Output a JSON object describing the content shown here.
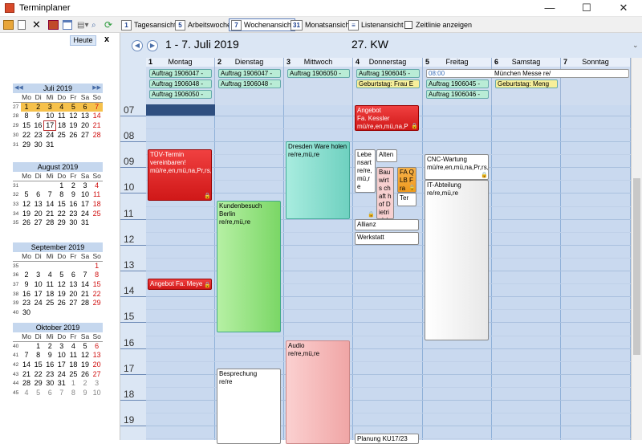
{
  "window": {
    "title": "Terminplaner",
    "minimize": "—",
    "maximize": "☐",
    "close": "✕"
  },
  "toolbar": {
    "views": [
      "Tagesansicht",
      "Arbeitswoche",
      "Wochenansicht",
      "Monatsansicht",
      "Listenansicht"
    ],
    "view_icons": [
      "1",
      "5",
      "7",
      "31",
      "≡"
    ],
    "timeline": "Zeitlinie anzeigen"
  },
  "sidebar": {
    "today_button": "Heute",
    "close": "x",
    "months": [
      {
        "title": "Juli 2019",
        "weekdays": [
          "Mo",
          "Di",
          "Mi",
          "Do",
          "Fr",
          "Sa",
          "So"
        ],
        "rows": [
          {
            "wk": "27",
            "days": [
              "1",
              "2",
              "3",
              "4",
              "5",
              "6",
              "7"
            ]
          },
          {
            "wk": "28",
            "days": [
              "8",
              "9",
              "10",
              "11",
              "12",
              "13",
              "14"
            ]
          },
          {
            "wk": "29",
            "days": [
              "15",
              "16",
              "17",
              "18",
              "19",
              "20",
              "21"
            ]
          },
          {
            "wk": "30",
            "days": [
              "22",
              "23",
              "24",
              "25",
              "26",
              "27",
              "28"
            ]
          },
          {
            "wk": "31",
            "days": [
              "29",
              "30",
              "31",
              "",
              "",
              "",
              ""
            ]
          }
        ]
      },
      {
        "title": "August 2019",
        "weekdays": [
          "Mo",
          "Di",
          "Mi",
          "Do",
          "Fr",
          "Sa",
          "So"
        ],
        "rows": [
          {
            "wk": "31",
            "days": [
              "",
              "",
              "",
              "1",
              "2",
              "3",
              "4"
            ]
          },
          {
            "wk": "32",
            "days": [
              "5",
              "6",
              "7",
              "8",
              "9",
              "10",
              "11"
            ]
          },
          {
            "wk": "33",
            "days": [
              "12",
              "13",
              "14",
              "15",
              "16",
              "17",
              "18"
            ]
          },
          {
            "wk": "34",
            "days": [
              "19",
              "20",
              "21",
              "22",
              "23",
              "24",
              "25"
            ]
          },
          {
            "wk": "35",
            "days": [
              "26",
              "27",
              "28",
              "29",
              "30",
              "31",
              ""
            ]
          }
        ]
      },
      {
        "title": "September 2019",
        "weekdays": [
          "Mo",
          "Di",
          "Mi",
          "Do",
          "Fr",
          "Sa",
          "So"
        ],
        "rows": [
          {
            "wk": "35",
            "days": [
              "",
              "",
              "",
              "",
              "",
              "",
              "1"
            ]
          },
          {
            "wk": "36",
            "days": [
              "2",
              "3",
              "4",
              "5",
              "6",
              "7",
              "8"
            ]
          },
          {
            "wk": "37",
            "days": [
              "9",
              "10",
              "11",
              "12",
              "13",
              "14",
              "15"
            ]
          },
          {
            "wk": "38",
            "days": [
              "16",
              "17",
              "18",
              "19",
              "20",
              "21",
              "22"
            ]
          },
          {
            "wk": "39",
            "days": [
              "23",
              "24",
              "25",
              "26",
              "27",
              "28",
              "29"
            ]
          },
          {
            "wk": "40",
            "days": [
              "30",
              "",
              "",
              "",
              "",
              "",
              ""
            ]
          }
        ]
      },
      {
        "title": "Oktober 2019",
        "weekdays": [
          "Mo",
          "Di",
          "Mi",
          "Do",
          "Fr",
          "Sa",
          "So"
        ],
        "rows": [
          {
            "wk": "40",
            "days": [
              "",
              "1",
              "2",
              "3",
              "4",
              "5",
              "6"
            ]
          },
          {
            "wk": "41",
            "days": [
              "7",
              "8",
              "9",
              "10",
              "11",
              "12",
              "13"
            ]
          },
          {
            "wk": "42",
            "days": [
              "14",
              "15",
              "16",
              "17",
              "18",
              "19",
              "20"
            ]
          },
          {
            "wk": "43",
            "days": [
              "21",
              "22",
              "23",
              "24",
              "25",
              "26",
              "27"
            ]
          },
          {
            "wk": "44",
            "days": [
              "28",
              "29",
              "30",
              "31",
              "1",
              "2",
              "3"
            ]
          },
          {
            "wk": "45",
            "days": [
              "4",
              "5",
              "6",
              "7",
              "8",
              "9",
              "10"
            ]
          }
        ]
      }
    ]
  },
  "header": {
    "period": "1 - 7. Juli 2019",
    "week": "27. KW"
  },
  "days": [
    {
      "num": "1",
      "name": "Montag"
    },
    {
      "num": "2",
      "name": "Dienstag"
    },
    {
      "num": "3",
      "name": "Mittwoch"
    },
    {
      "num": "4",
      "name": "Donnerstag"
    },
    {
      "num": "5",
      "name": "Freitag"
    },
    {
      "num": "6",
      "name": "Samstag"
    },
    {
      "num": "7",
      "name": "Sonntag"
    }
  ],
  "hours": [
    "07",
    "08",
    "09",
    "10",
    "11",
    "12",
    "13",
    "14",
    "15",
    "16",
    "17",
    "18",
    "19"
  ],
  "allday": {
    "mon": [
      "Auftrag 1906047 -",
      "Auftrag 1906048 -",
      "Auftrag 1906050 -"
    ],
    "tue": [
      "Auftrag 1906047 -",
      "Auftrag 1906048 -"
    ],
    "wed": [
      "Auftrag 1906050 -"
    ],
    "thu": [
      "Auftrag 1906045 -",
      "Geburtstag: Frau E"
    ],
    "fri_time": "08:00",
    "fri_event": "München Messe  re/",
    "fri": [
      "Auftrag 1906045 -",
      "Auftrag 1906046 -"
    ],
    "sat": [
      "Geburtstag: Meng"
    ]
  },
  "events": {
    "tuev": "TÜV-Termin vereinbaren!\nmü/re,en,mü,na,Pr,rs,re,st,th,vr,we",
    "angebot_meyer": "Angebot Fa. Meye",
    "kundenbesuch": "Kundenbesuch Berlin\nre/re,mü,re",
    "besprechung": "Besprechung\nre/re",
    "dresden": "Dresden Ware holen\nre/re,mü,re",
    "audio": "Audio\nre/re,mü,re",
    "angebot_kessler": "Angebot\nFa. Kessler\nmü/re,en,mü,na,P",
    "lebensart": "Lebe nsart re/re, mü,r e",
    "alten": "Alten",
    "bau": "Bau wirts chaft hof Dietri ch/",
    "fa": "FA QLB Fra",
    "ter": "Ter",
    "allianz": "Allianz",
    "werkstatt": "Werkstatt",
    "planung": "Planung KU17/23",
    "cnc": "CNC-Wartung\nmü/re,en,mü,na,Pr,rs,re,st,th,vr,we",
    "it": "IT-Abteilung\nre/re,mü,re"
  }
}
